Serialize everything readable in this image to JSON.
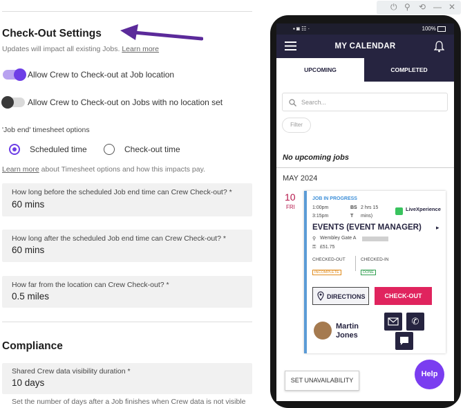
{
  "settings": {
    "title": "Check-Out Settings",
    "subtitle": "Updates will impact all existing Jobs.",
    "learn_more": "Learn more",
    "toggle1_label": "Allow Crew to Check-out at Job location",
    "toggle1_on": true,
    "toggle2_label": "Allow Crew to Check-out on Jobs with no location set",
    "toggle2_on": false,
    "timesheet_label": "'Job end' timesheet options",
    "radio1_label": "Scheduled time",
    "radio2_label": "Check-out time",
    "learn_more2": "Learn more",
    "learn_more2_rest": " about Timesheet options and how this impacts pay.",
    "fields": [
      {
        "label": "How long before the scheduled Job end time can Crew Check-out? *",
        "value": "60 mins"
      },
      {
        "label": "How long after the scheduled Job end time can Crew Check-out? *",
        "value": "60 mins"
      },
      {
        "label": "How far from the location can Crew Check-out? *",
        "value": "0.5 miles"
      }
    ]
  },
  "compliance": {
    "title": "Compliance",
    "field_label": "Shared Crew data visibility duration *",
    "field_value": "10 days",
    "helper": "Set the number of days after a Job finishes when Crew data is not visible"
  },
  "phone": {
    "status_right": "100%",
    "title": "MY CALENDAR",
    "tab_upcoming": "UPCOMING",
    "tab_completed": "COMPLETED",
    "search_placeholder": "Search...",
    "filter": "Filter",
    "no_jobs": "No upcoming jobs",
    "month": "MAY 2024",
    "date_num": "10",
    "date_dow": "FRI",
    "job_status": "JOB IN PROGRESS",
    "time_start": "1:00pm",
    "time_end": "3:15pm",
    "duration_a": "BS",
    "duration_b": "T",
    "duration_c": "2 hrs 15",
    "duration_d": "mins)",
    "brand": "LiveXperience",
    "event": "EVENTS (EVENT MANAGER)",
    "location": "Wembley Gate A",
    "pay": "£51.75",
    "checked_out": "CHECKED-OUT",
    "checked_in": "CHECKED-IN",
    "badge_out": "INCOMPLETE",
    "badge_in": "DONE",
    "directions": "DIRECTIONS",
    "checkout": "CHECK-OUT",
    "person_first": "Martin",
    "person_last": "Jones",
    "unavailability": "SET UNAVAILABILITY",
    "help": "Help"
  },
  "colors": {
    "accent": "#6d3ee6",
    "navy": "#262440",
    "checkout": "#e0245e",
    "arrow": "#5b2a9a"
  }
}
